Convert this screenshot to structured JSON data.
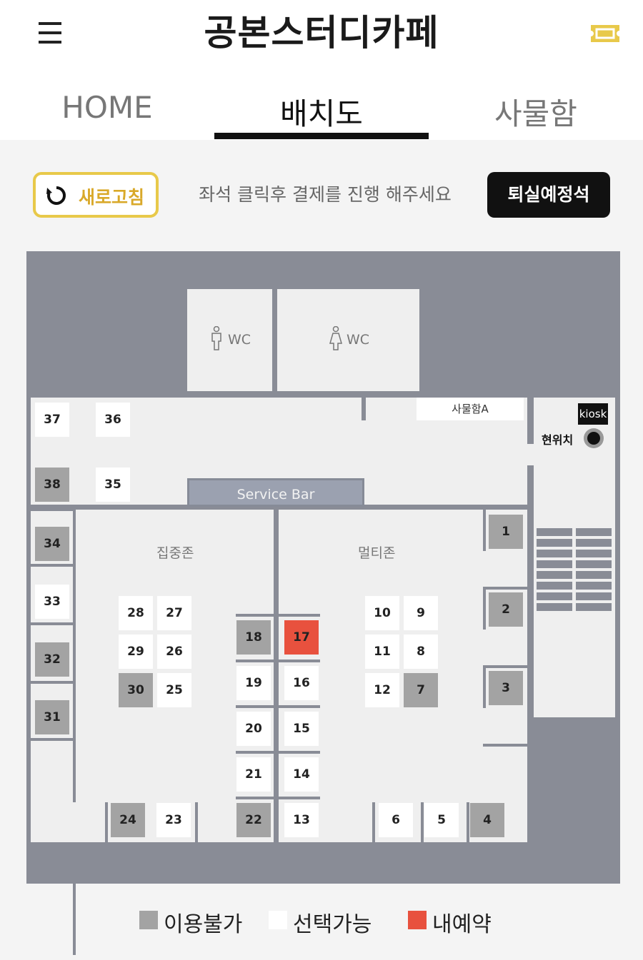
{
  "header": {
    "brand": "공본스터디카페"
  },
  "tabs": [
    {
      "label": "HOME"
    },
    {
      "label": "배치도"
    },
    {
      "label": "사물함"
    }
  ],
  "toolbar": {
    "refresh_label": "새로고침",
    "guide_text": "좌석 클릭후 결제를 진행 해주세요",
    "checkout_label": "퇴실예정석"
  },
  "map": {
    "wc_left": "WC",
    "wc_right": "WC",
    "service_bar": "Service Bar",
    "locker_a": "사물함A",
    "kiosk": "kiosk",
    "current_position": "현위치",
    "zone_focus": "집중존",
    "zone_multi": "멀티존"
  },
  "seats": [
    {
      "num": "37",
      "status": "available"
    },
    {
      "num": "36",
      "status": "available"
    },
    {
      "num": "38",
      "status": "unavailable"
    },
    {
      "num": "35",
      "status": "available"
    },
    {
      "num": "34",
      "status": "unavailable"
    },
    {
      "num": "33",
      "status": "available"
    },
    {
      "num": "32",
      "status": "unavailable"
    },
    {
      "num": "31",
      "status": "unavailable"
    },
    {
      "num": "28",
      "status": "available"
    },
    {
      "num": "27",
      "status": "available"
    },
    {
      "num": "29",
      "status": "available"
    },
    {
      "num": "26",
      "status": "available"
    },
    {
      "num": "30",
      "status": "unavailable"
    },
    {
      "num": "25",
      "status": "available"
    },
    {
      "num": "18",
      "status": "unavailable"
    },
    {
      "num": "17",
      "status": "mine"
    },
    {
      "num": "19",
      "status": "available"
    },
    {
      "num": "16",
      "status": "available"
    },
    {
      "num": "20",
      "status": "available"
    },
    {
      "num": "15",
      "status": "available"
    },
    {
      "num": "21",
      "status": "available"
    },
    {
      "num": "14",
      "status": "available"
    },
    {
      "num": "22",
      "status": "unavailable"
    },
    {
      "num": "13",
      "status": "available"
    },
    {
      "num": "24",
      "status": "unavailable"
    },
    {
      "num": "23",
      "status": "available"
    },
    {
      "num": "10",
      "status": "available"
    },
    {
      "num": "9",
      "status": "available"
    },
    {
      "num": "11",
      "status": "available"
    },
    {
      "num": "8",
      "status": "available"
    },
    {
      "num": "12",
      "status": "available"
    },
    {
      "num": "7",
      "status": "unavailable"
    },
    {
      "num": "1",
      "status": "unavailable"
    },
    {
      "num": "2",
      "status": "unavailable"
    },
    {
      "num": "3",
      "status": "unavailable"
    },
    {
      "num": "6",
      "status": "available"
    },
    {
      "num": "5",
      "status": "available"
    },
    {
      "num": "4",
      "status": "unavailable"
    }
  ],
  "legend": [
    {
      "label": "이용불가",
      "color": "#a3a3a3"
    },
    {
      "label": "선택가능",
      "color": "#ffffff"
    },
    {
      "label": "내예약",
      "color": "#e8513e"
    }
  ],
  "colors": {
    "accent": "#e8c94a",
    "mine": "#e8513e",
    "unavailable": "#a3a3a3",
    "map_bg": "#898c96"
  }
}
